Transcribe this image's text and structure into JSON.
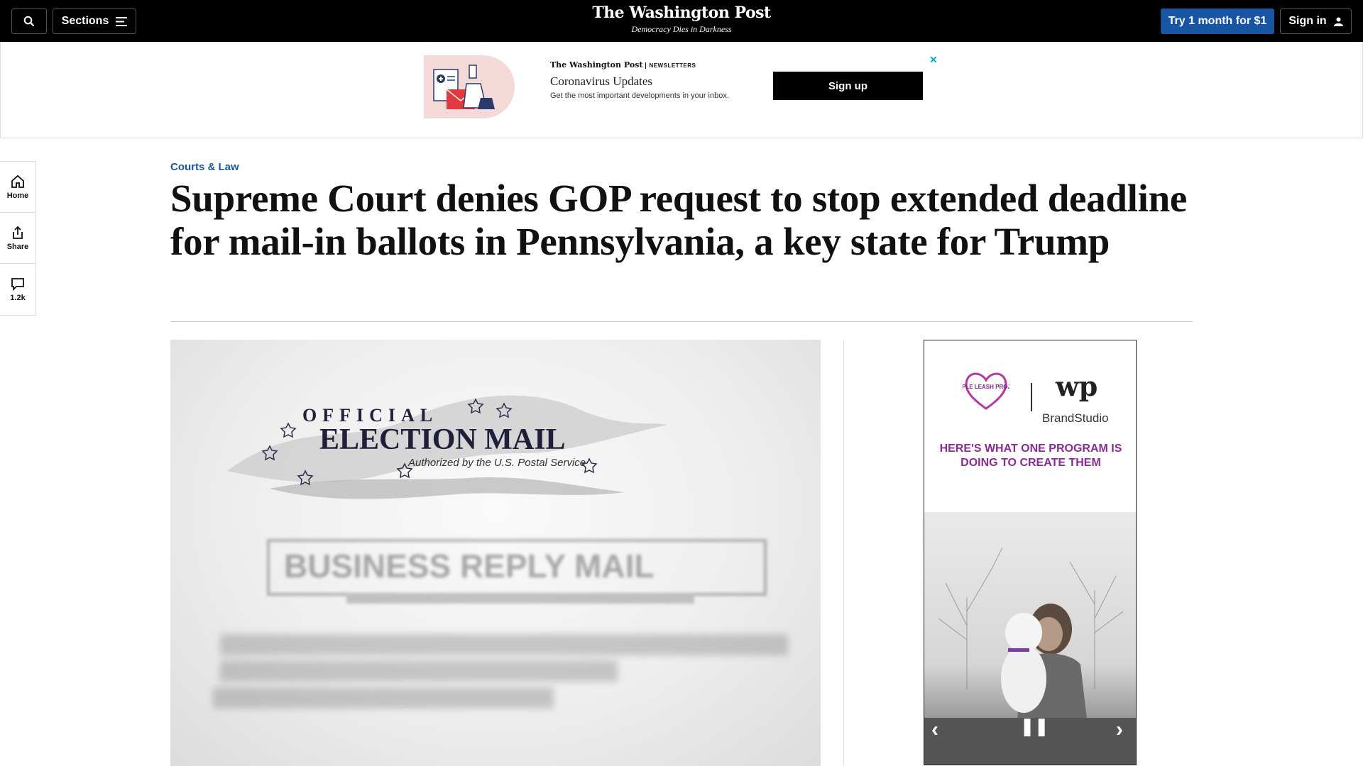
{
  "topbar": {
    "sections_label": "Sections",
    "masthead_title": "The Washington Post",
    "masthead_tagline": "Democracy Dies in Darkness",
    "try_label": "Try 1 month for $1",
    "signin_label": "Sign in"
  },
  "newsletter_ad": {
    "brand": "The Washington Post",
    "brand_section": "NEWSLETTERS",
    "title": "Coronavirus Updates",
    "description": "Get the most important developments in your inbox.",
    "signup_label": "Sign up",
    "close_glyph": "✕"
  },
  "rail": {
    "home": "Home",
    "share": "Share",
    "comments_count": "1.2k"
  },
  "article": {
    "kicker": "Courts & Law",
    "headline": "Supreme Court denies GOP request to stop extended deadline for mail-in ballots in Pennsylvania, a key state for Trump"
  },
  "lead_image": {
    "official": "OFFICIAL",
    "election_mail": "ELECTION MAIL",
    "authorized": "Authorized by the U.S. Postal Service",
    "business_reply": "BUSINESS REPLY MAIL"
  },
  "side_ad": {
    "partner_logo_text": "PURPLE LEASH PROJECT",
    "wp_mark": "wp",
    "brand_studio": "BrandStudio",
    "headline": "HERE'S WHAT ONE PROGRAM IS DOING TO CREATE THEM"
  },
  "colors": {
    "topbar_bg": "#000000",
    "accent_blue": "#1955a5",
    "ad_purple": "#8a2b93"
  }
}
